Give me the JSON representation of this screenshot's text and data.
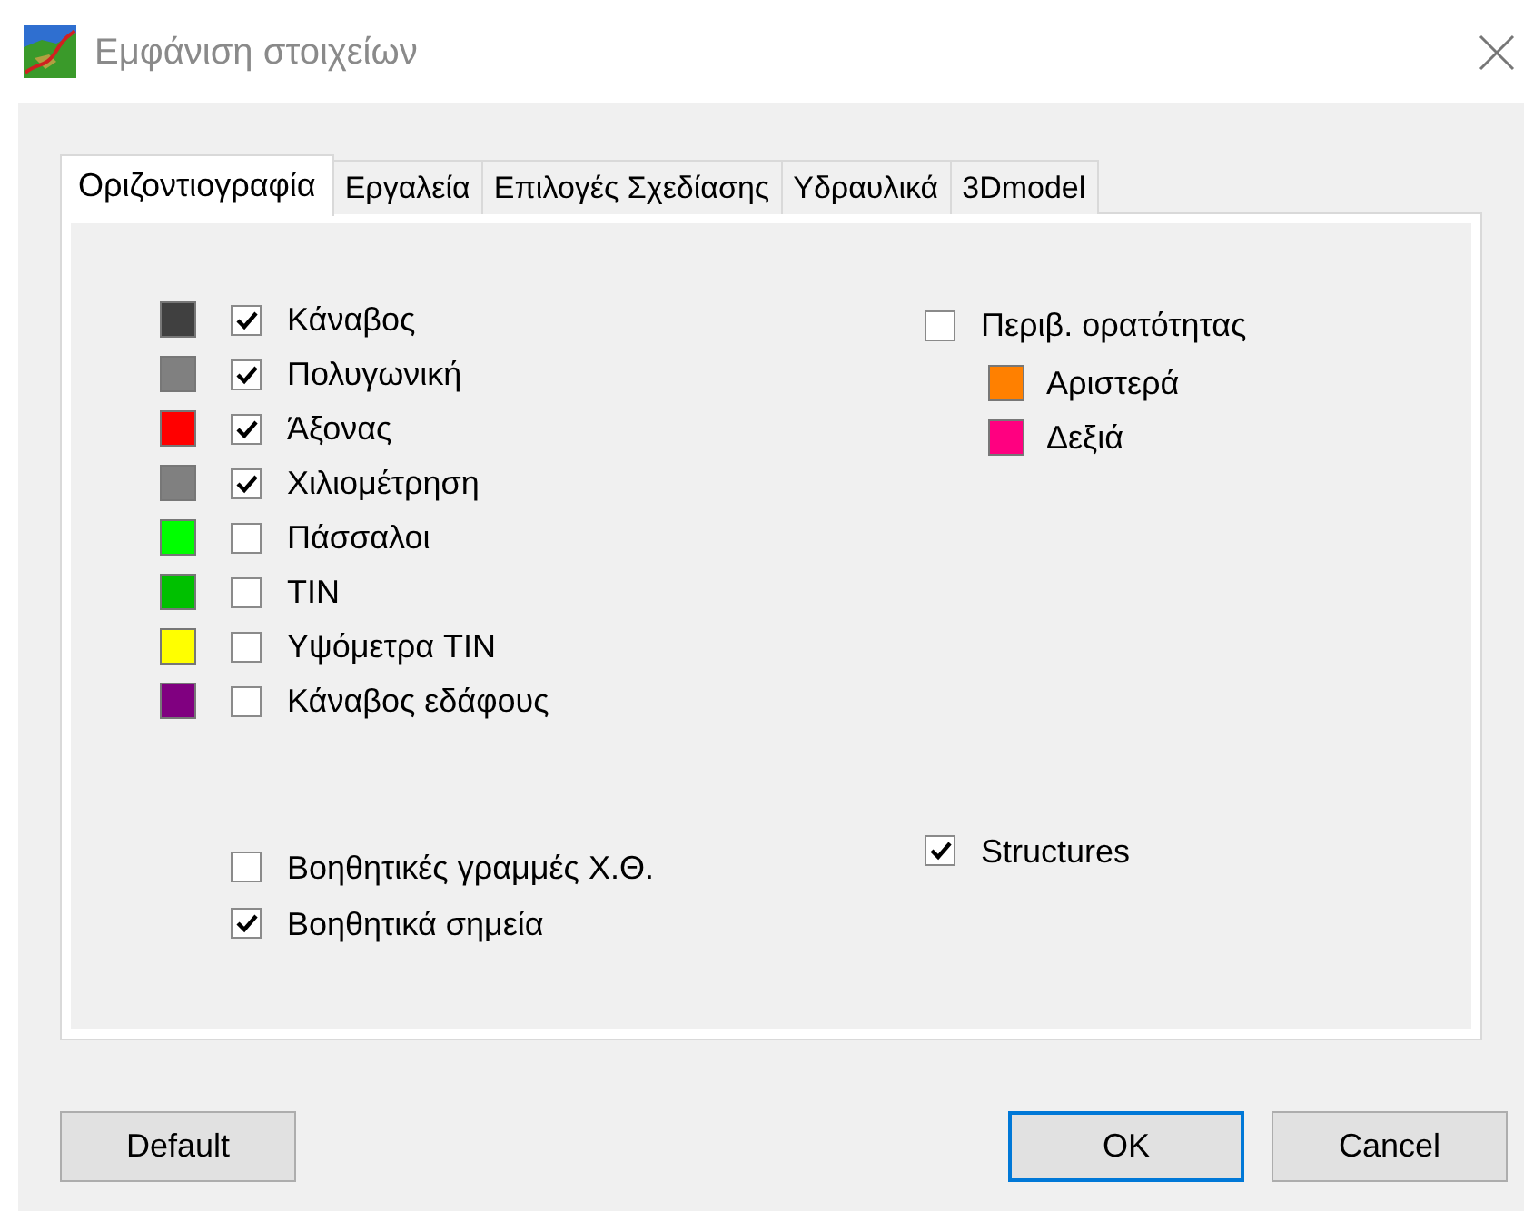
{
  "window": {
    "title": "Εμφάνιση στοιχείων"
  },
  "tabs": [
    {
      "label": "Οριζοντιογραφία",
      "selected": true
    },
    {
      "label": "Εργαλεία",
      "selected": false
    },
    {
      "label": "Επιλογές Σχεδίασης",
      "selected": false
    },
    {
      "label": "Υδραυλικά",
      "selected": false
    },
    {
      "label": "3Dmodel",
      "selected": false
    }
  ],
  "layers": [
    {
      "label": "Κάναβος",
      "color": "#404040",
      "checked": true
    },
    {
      "label": "Πολυγωνική",
      "color": "#808080",
      "checked": true
    },
    {
      "label": "Άξονας",
      "color": "#ff0000",
      "checked": true
    },
    {
      "label": "Χιλιομέτρηση",
      "color": "#808080",
      "checked": true
    },
    {
      "label": "Πάσσαλοι",
      "color": "#00ff00",
      "checked": false
    },
    {
      "label": "TIN",
      "color": "#00c000",
      "checked": false
    },
    {
      "label": "Υψόμετρα TIN",
      "color": "#ffff00",
      "checked": false
    },
    {
      "label": "Κάναβος εδάφους",
      "color": "#800080",
      "checked": false
    }
  ],
  "visibility": {
    "label": "Περιβ. ορατότητας",
    "checked": false,
    "sides": [
      {
        "label": "Αριστερά",
        "color": "#ff8000"
      },
      {
        "label": "Δεξιά",
        "color": "#ff0080"
      }
    ]
  },
  "extras_left": [
    {
      "label": "Βοηθητικές γραμμές Χ.Θ.",
      "checked": false
    },
    {
      "label": "Βοηθητικά σημεία",
      "checked": true
    }
  ],
  "extras_right": [
    {
      "label": "Structures",
      "checked": true
    }
  ],
  "buttons": [
    {
      "label": "Default",
      "default": false
    },
    {
      "label": "OK",
      "default": true
    },
    {
      "label": "Cancel",
      "default": false
    }
  ]
}
